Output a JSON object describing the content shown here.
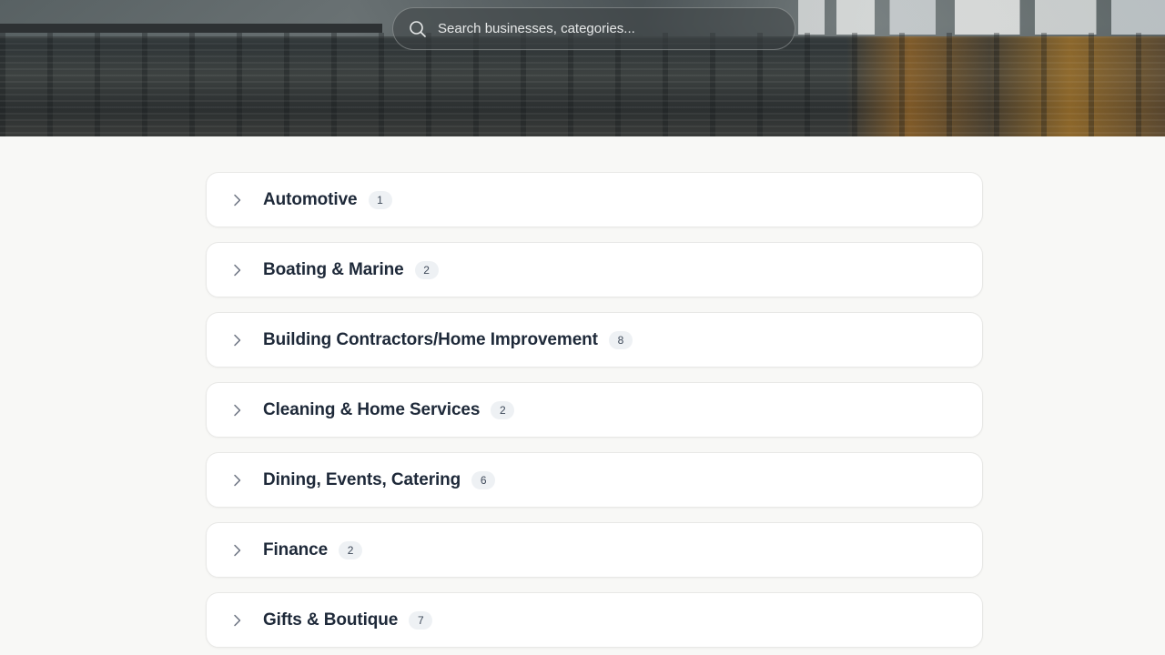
{
  "search": {
    "placeholder": "Search businesses, categories..."
  },
  "categories": [
    {
      "name": "Automotive",
      "count": "1"
    },
    {
      "name": "Boating & Marine",
      "count": "2"
    },
    {
      "name": "Building Contractors/Home Improvement",
      "count": "8"
    },
    {
      "name": "Cleaning & Home Services",
      "count": "2"
    },
    {
      "name": "Dining, Events, Catering",
      "count": "6"
    },
    {
      "name": "Finance",
      "count": "2"
    },
    {
      "name": "Gifts & Boutique",
      "count": "7"
    }
  ],
  "icons": {
    "search": "search-icon",
    "expand": "chevron-right-icon"
  },
  "colors": {
    "page_bg": "#f8f8f6",
    "title_text": "#1e2939",
    "badge_bg": "#eef1f4",
    "chevron": "#6b7280"
  }
}
